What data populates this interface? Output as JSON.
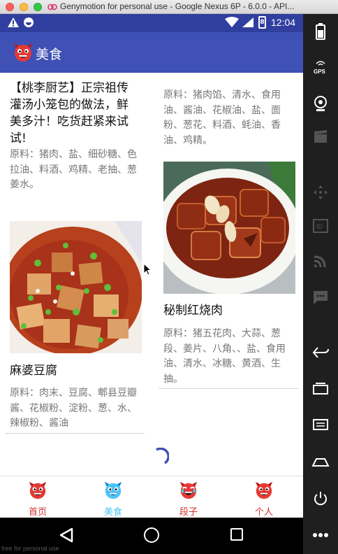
{
  "window": {
    "title": "Genymotion for personal use - Google Nexus 6P - 6.0.0 - API..."
  },
  "statusbar": {
    "time": "12:04",
    "battery": "8"
  },
  "appbar": {
    "title": "美食"
  },
  "cards": {
    "left": [
      {
        "title": "【桃李厨艺】正宗祖传灌汤小笼包的做法，鲜美多汁！吃货赶紧来试试!",
        "desc": "原料：猪肉、盐、细砂糖、色拉油、料酒、鸡精、老抽、葱姜水。"
      },
      {
        "title": "麻婆豆腐",
        "desc": "原料：肉末、豆腐、郫县豆瓣酱、花椒粉、淀粉、葱、水、辣椒粉、酱油"
      }
    ],
    "right": [
      {
        "title": "",
        "desc": "原料：猪肉馅、清水、食用油、酱油、花椒油、盐、面粉、葱花、料酒、蚝油、香油、鸡精。"
      },
      {
        "title": "秘制红烧肉",
        "desc": "原料：猪五花肉、大蒜、葱段、姜片、八角、、盐、食用油、清水、冰糖、黄酒、生抽。"
      }
    ]
  },
  "bottom_nav": [
    {
      "label": "首页",
      "icon": "demon-face-icon-red",
      "active": false
    },
    {
      "label": "美食",
      "icon": "demon-face-icon-blue",
      "active": true
    },
    {
      "label": "段子",
      "icon": "demon-face-icon-laughing",
      "active": false
    },
    {
      "label": "个人",
      "icon": "demon-face-icon-red",
      "active": false
    }
  ],
  "watermark": "free for personal use",
  "colors": {
    "statusbar": "#303f9f",
    "appbar": "#3f51b5",
    "nav_active": "#4fc3f7",
    "nav_inactive": "#d32f2f"
  }
}
